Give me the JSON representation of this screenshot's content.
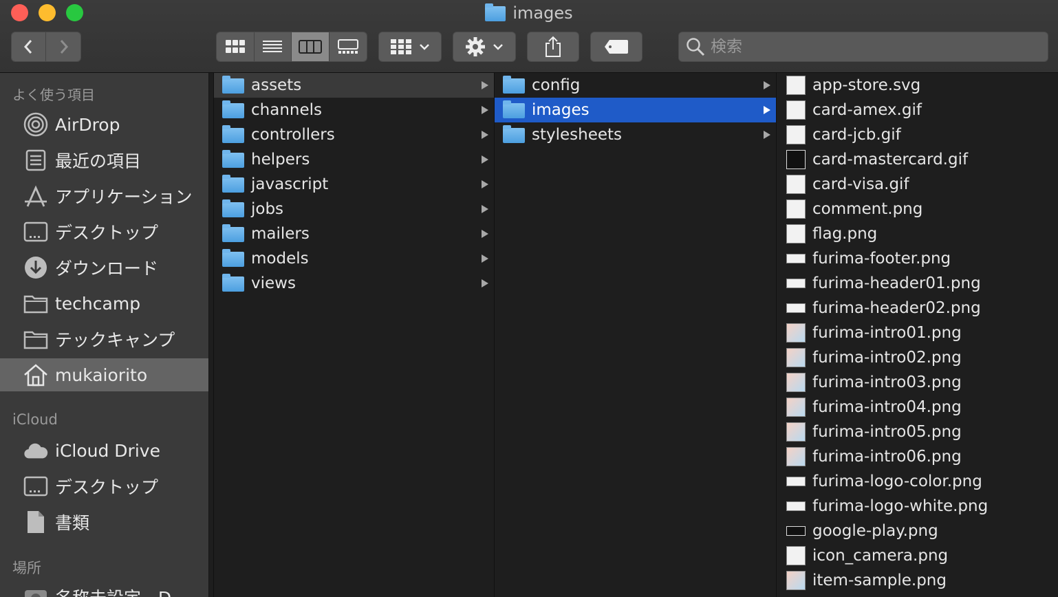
{
  "window": {
    "title": "images",
    "traffic_lights": {
      "close": "#fe5f57",
      "minimize": "#febc2e",
      "zoom": "#28c840"
    }
  },
  "toolbar": {
    "back_icon": "chevron-left-icon",
    "forward_icon": "chevron-right-icon",
    "view_modes": [
      "icon-view-icon",
      "list-view-icon",
      "column-view-icon",
      "gallery-view-icon"
    ],
    "active_view": "column-view-icon",
    "group_icon": "group-icon",
    "action_icon": "gear-icon",
    "share_icon": "share-icon",
    "tag_icon": "tag-icon",
    "search_placeholder": "検索"
  },
  "sidebar": {
    "favorites_header": "よく使う項目",
    "favorites": [
      {
        "label": "AirDrop",
        "icon": "airdrop-icon"
      },
      {
        "label": "最近の項目",
        "icon": "recents-icon"
      },
      {
        "label": "アプリケーション",
        "icon": "applications-icon"
      },
      {
        "label": "デスクトップ",
        "icon": "desktop-icon"
      },
      {
        "label": "ダウンロード",
        "icon": "downloads-icon"
      },
      {
        "label": "techcamp",
        "icon": "folder-icon"
      },
      {
        "label": "テックキャンプ",
        "icon": "folder-icon"
      },
      {
        "label": "mukaiorito",
        "icon": "home-icon"
      }
    ],
    "icloud_header": "iCloud",
    "icloud": [
      {
        "label": "iCloud Drive",
        "icon": "cloud-icon"
      },
      {
        "label": "デスクトップ",
        "icon": "desktop-icon"
      },
      {
        "label": "書類",
        "icon": "document-icon"
      }
    ],
    "locations_header": "場所",
    "locations_partial": "名称未設定 - D"
  },
  "columns": {
    "col1": [
      "assets",
      "channels",
      "controllers",
      "helpers",
      "javascript",
      "jobs",
      "mailers",
      "models",
      "views"
    ],
    "col2": [
      "config",
      "images",
      "stylesheets"
    ],
    "col3": [
      "app-store.svg",
      "card-amex.gif",
      "card-jcb.gif",
      "card-mastercard.gif",
      "card-visa.gif",
      "comment.png",
      "flag.png",
      "furima-footer.png",
      "furima-header01.png",
      "furima-header02.png",
      "furima-intro01.png",
      "furima-intro02.png",
      "furima-intro03.png",
      "furima-intro04.png",
      "furima-intro05.png",
      "furima-intro06.png",
      "furima-logo-color.png",
      "furima-logo-white.png",
      "google-play.png",
      "icon_camera.png",
      "item-sample.png"
    ]
  }
}
